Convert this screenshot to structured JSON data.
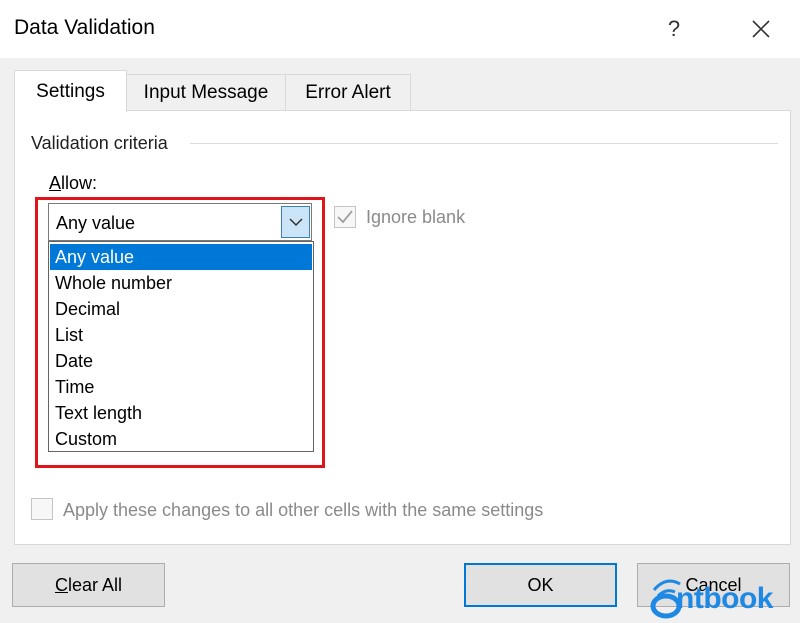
{
  "window": {
    "title": "Data Validation",
    "help_label": "?",
    "close_label": "✕"
  },
  "tabs": [
    {
      "label": "Settings",
      "active": true
    },
    {
      "label": "Input Message",
      "active": false
    },
    {
      "label": "Error Alert",
      "active": false
    }
  ],
  "validation_criteria": {
    "group_label": "Validation criteria",
    "allow_label_first": "A",
    "allow_label_rest": "llow:",
    "allow_selected": "Any value",
    "allow_options": [
      "Any value",
      "Whole number",
      "Decimal",
      "List",
      "Date",
      "Time",
      "Text length",
      "Custom"
    ],
    "ignore_blank_label": "Ignore blank",
    "ignore_blank_checked": true
  },
  "apply_changes": {
    "label": "Apply these changes to all other cells with the same settings",
    "checked": false
  },
  "buttons": {
    "clear_all_first": "C",
    "clear_all_rest": "lear All",
    "ok": "OK",
    "cancel": "Cancel"
  },
  "watermark": {
    "text": "ntbook",
    "color": "#1e88e5"
  },
  "colors": {
    "highlight": "#e0141b",
    "selection": "#0078d7",
    "accent": "#0078d7"
  }
}
